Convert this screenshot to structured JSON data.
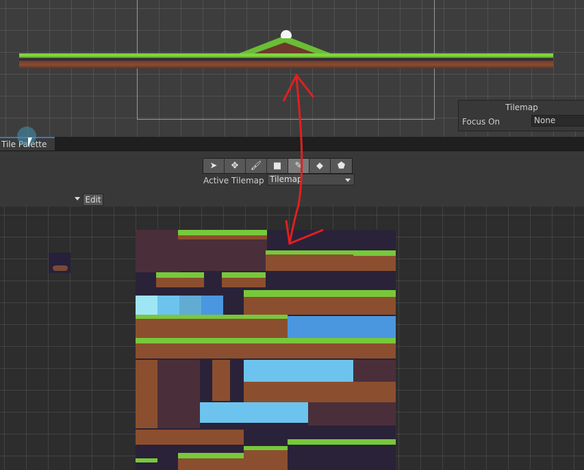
{
  "scene": {
    "overlay": {
      "title": "Tilemap",
      "focus_label": "Focus On",
      "focus_value": "None"
    }
  },
  "tab": {
    "label": "Tile Palette"
  },
  "toolbar": {
    "tools": [
      {
        "icon": "select-icon",
        "glyph": "➤"
      },
      {
        "icon": "move-icon",
        "glyph": "✥"
      },
      {
        "icon": "brush-icon",
        "glyph": "🖌"
      },
      {
        "icon": "box-fill-icon",
        "glyph": "■"
      },
      {
        "icon": "picker-icon",
        "glyph": "✎"
      },
      {
        "icon": "eraser-icon",
        "glyph": "◆"
      },
      {
        "icon": "fill-bucket-icon",
        "glyph": "⬟"
      }
    ],
    "active_tool_index": 4,
    "active_tilemap_label": "Active Tilemap",
    "active_tilemap_value": "Tilemap",
    "edit_label": "Edit"
  },
  "colors": {
    "annotation_arrow": "#e02020",
    "tab_accent": "#3a79bb",
    "grass": "#78c83b",
    "dirt": "#8b4f2f",
    "water": "#4a97e0"
  }
}
